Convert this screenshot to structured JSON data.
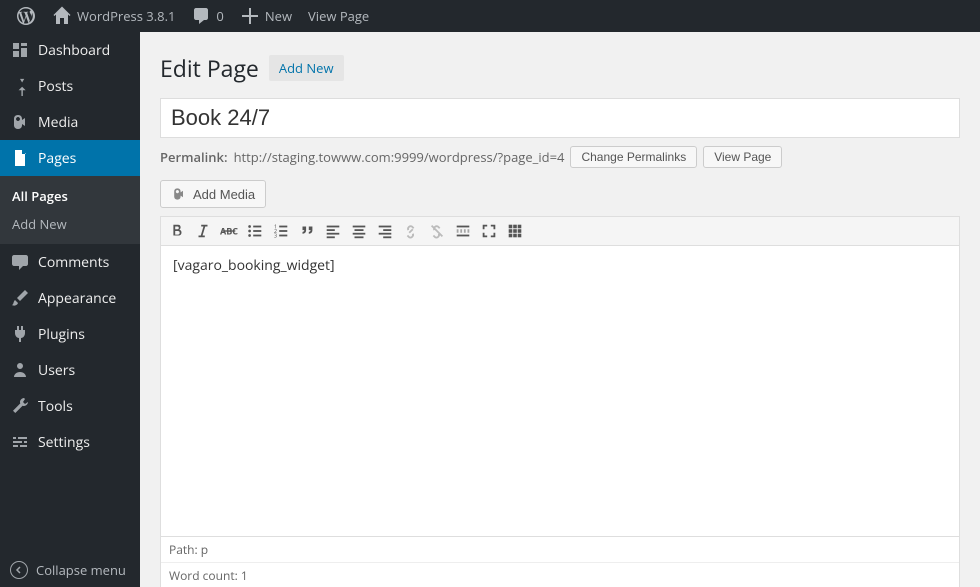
{
  "toolbar": {
    "site_name": "WordPress 3.8.1",
    "comments_count": "0",
    "new_label": "New",
    "view_page_label": "View Page"
  },
  "sidebar": {
    "items": [
      {
        "label": "Dashboard",
        "icon": "dashboard"
      },
      {
        "label": "Posts",
        "icon": "pin"
      },
      {
        "label": "Media",
        "icon": "media"
      },
      {
        "label": "Pages",
        "icon": "page",
        "current": true
      },
      {
        "label": "Comments",
        "icon": "comment"
      },
      {
        "label": "Appearance",
        "icon": "brush"
      },
      {
        "label": "Plugins",
        "icon": "plug"
      },
      {
        "label": "Users",
        "icon": "user"
      },
      {
        "label": "Tools",
        "icon": "wrench"
      },
      {
        "label": "Settings",
        "icon": "sliders"
      }
    ],
    "submenu": [
      "All Pages",
      "Add New"
    ],
    "collapse_label": "Collapse menu"
  },
  "page": {
    "heading": "Edit Page",
    "add_new": "Add New",
    "title_value": "Book 24/7",
    "permalink_label": "Permalink:",
    "permalink_url": "http://staging.towww.com:9999/wordpress/?page_id=4",
    "change_permalinks_btn": "Change Permalinks",
    "view_page_btn": "View Page",
    "add_media_btn": "Add Media",
    "editor_content": "[vagaro_booking_widget]",
    "path_label": "Path: p",
    "wordcount_label": "Word count: 1"
  }
}
